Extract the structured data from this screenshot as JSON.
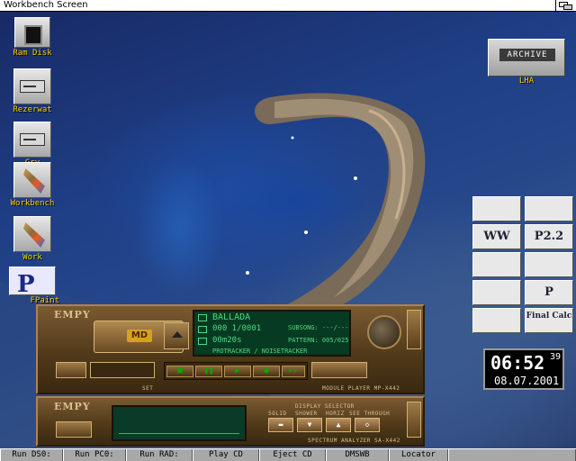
{
  "titlebar": {
    "title": "Workbench Screen"
  },
  "desktop_icons": [
    {
      "label": "Ram Disk"
    },
    {
      "label": "Rezerwat"
    },
    {
      "label": "Gry"
    },
    {
      "label": "Workbench"
    },
    {
      "label": "Work"
    },
    {
      "label": "FPaint"
    }
  ],
  "lha": {
    "label": "LHA",
    "pic_text": "ARCHIVE"
  },
  "toolgrid": {
    "buttons": [
      "",
      "",
      "WW",
      "P2.2",
      "",
      "",
      "",
      "P",
      "",
      "Final Calc"
    ]
  },
  "clock": {
    "time": "06:52",
    "seconds": "39",
    "date": "08.07.2001"
  },
  "player": {
    "brand": "EMPY",
    "md_label": "MD",
    "title": "BALLADA",
    "position": "000 1/0001",
    "time": "00m20s",
    "subsong_label": "SUBSONG: ---/---",
    "pattern_label": "PATTERN: 005/025",
    "format": "PROTRACKER / NOISETRACKER",
    "set_label": "SET",
    "model": "MODULE PLAYER MP-X442"
  },
  "analyzer": {
    "brand": "EMPY",
    "display_label": "DISPLAY SELECTOR",
    "modes": [
      "SOLID",
      "SHOWER",
      "HORIZ",
      "SEE THROUGH"
    ],
    "model": "SPECTRUM ANALYZER SA-X442"
  },
  "statusbar": {
    "items": [
      "Run DS0:",
      "Run PC0:",
      "Run RAD:",
      "Play CD",
      "Eject CD",
      "DMSWB",
      "Locator"
    ]
  }
}
